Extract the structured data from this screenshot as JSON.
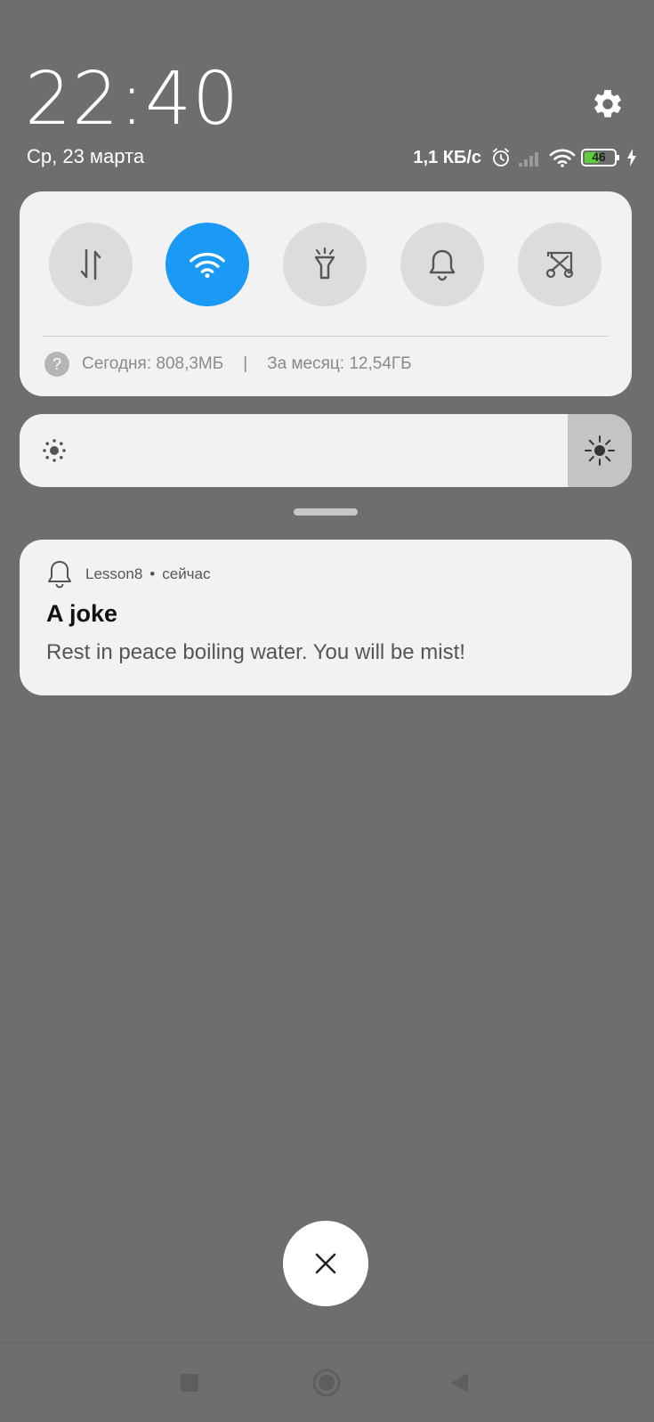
{
  "status": {
    "time": "22:40",
    "date": "Ср, 23 марта",
    "network_speed": "1,1 КБ/с",
    "battery_level": "46"
  },
  "quick_settings": {
    "tiles": [
      {
        "name": "mobile-data",
        "icon": "data-transfer-icon",
        "active": false
      },
      {
        "name": "wifi",
        "icon": "wifi-icon",
        "active": true
      },
      {
        "name": "flashlight",
        "icon": "flashlight-icon",
        "active": false
      },
      {
        "name": "sound",
        "icon": "bell-icon",
        "active": false
      },
      {
        "name": "screenshot",
        "icon": "scissors-icon",
        "active": false
      }
    ],
    "usage_today": "Сегодня: 808,3МБ",
    "usage_separator": "|",
    "usage_month": "За месяц: 12,54ГБ",
    "accent_color": "#1a9af5"
  },
  "brightness": {
    "level": 0.1
  },
  "notification": {
    "app_name": "Lesson8",
    "separator": "•",
    "time": "сейчас",
    "title": "A joke",
    "text": "Rest in peace boiling water. You will be mist!"
  }
}
